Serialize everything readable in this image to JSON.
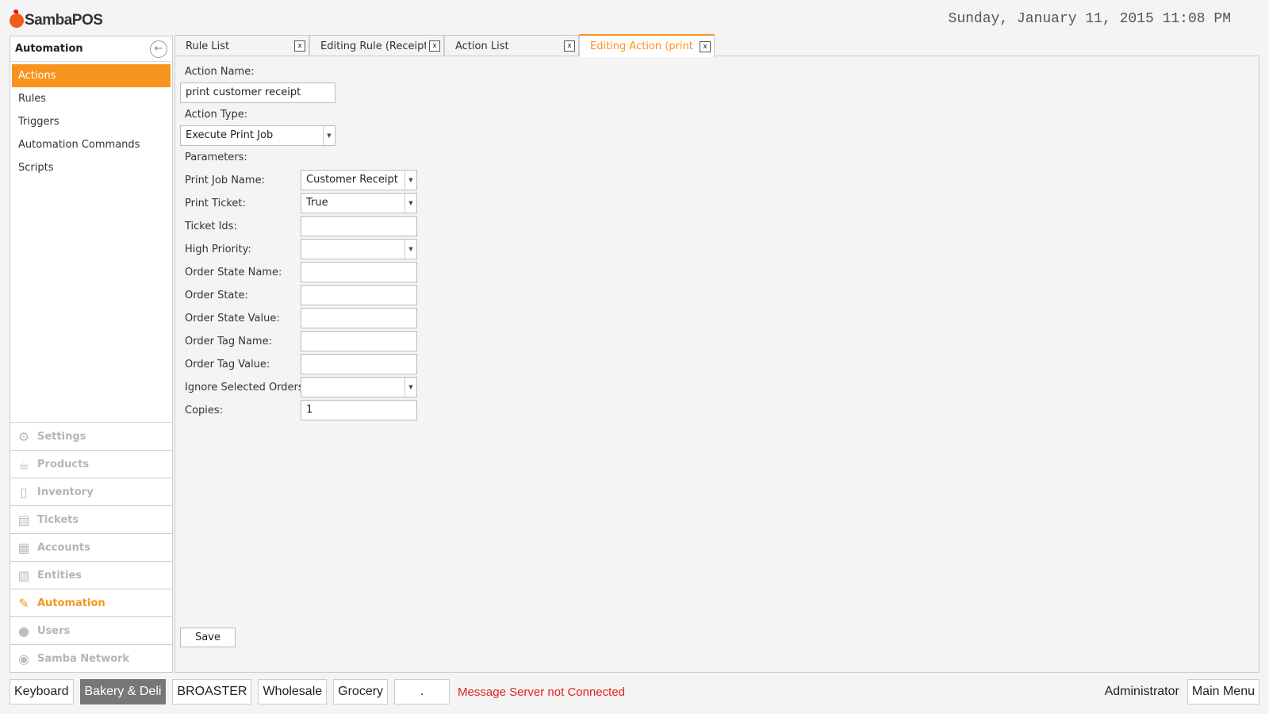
{
  "app": {
    "name": "SambaPOS"
  },
  "clock": "Sunday, January 11, 2015 11:08 PM",
  "sidebar": {
    "title": "Automation",
    "items": [
      {
        "label": "Actions",
        "active": true
      },
      {
        "label": "Rules"
      },
      {
        "label": "Triggers"
      },
      {
        "label": "Automation Commands"
      },
      {
        "label": "Scripts"
      }
    ],
    "nav": [
      {
        "label": "Settings",
        "icon": "gear-icon"
      },
      {
        "label": "Products",
        "icon": "coffee-cup-icon"
      },
      {
        "label": "Inventory",
        "icon": "box-icon"
      },
      {
        "label": "Tickets",
        "icon": "books-icon"
      },
      {
        "label": "Accounts",
        "icon": "calculator-icon"
      },
      {
        "label": "Entities",
        "icon": "calendar-grid-icon"
      },
      {
        "label": "Automation",
        "icon": "pencil-icon",
        "active": true
      },
      {
        "label": "Users",
        "icon": "user-icon"
      },
      {
        "label": "Samba Network",
        "icon": "globe-icon"
      }
    ]
  },
  "tabs": [
    {
      "label": "Rule List",
      "close": "x"
    },
    {
      "label": "Editing Rule (Receipt print)",
      "close": "x"
    },
    {
      "label": "Action List",
      "close": "x"
    },
    {
      "label": "Editing Action (print customer receipt)",
      "close": "x",
      "active": true
    }
  ],
  "form": {
    "action_name_label": "Action Name:",
    "action_name_value": "print customer receipt",
    "action_type_label": "Action Type:",
    "action_type_value": "Execute Print Job",
    "parameters_label": "Parameters:",
    "params": [
      {
        "label": "Print Job Name:",
        "value": "Customer Receipt",
        "combo": true
      },
      {
        "label": "Print Ticket:",
        "value": "True",
        "combo": true
      },
      {
        "label": "Ticket Ids:",
        "value": ""
      },
      {
        "label": "High Priority:",
        "value": "",
        "combo": true
      },
      {
        "label": "Order State Name:",
        "value": ""
      },
      {
        "label": "Order State:",
        "value": ""
      },
      {
        "label": "Order State Value:",
        "value": ""
      },
      {
        "label": "Order Tag Name:",
        "value": ""
      },
      {
        "label": "Order Tag Value:",
        "value": ""
      },
      {
        "label": "Ignore Selected Orders:",
        "value": "",
        "combo": true
      },
      {
        "label": "Copies:",
        "value": "1"
      }
    ],
    "save_label": "Save"
  },
  "statusbar": {
    "buttons": [
      {
        "label": "Keyboard"
      },
      {
        "label": "Bakery & Deli",
        "dark": true
      },
      {
        "label": "BROASTER"
      },
      {
        "label": "Wholesale"
      },
      {
        "label": "Grocery"
      },
      {
        "label": "."
      }
    ],
    "message": "Message Server not Connected",
    "user": "Administrator",
    "main_menu": "Main Menu"
  },
  "colors": {
    "accent": "#f7941d",
    "error": "#e0201b"
  }
}
